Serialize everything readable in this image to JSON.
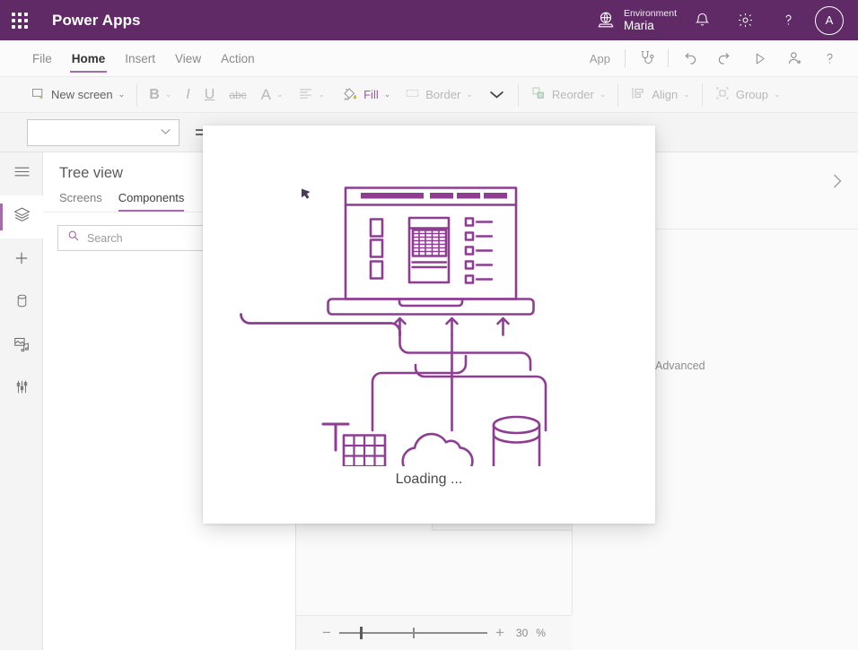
{
  "topbar": {
    "waffle_icon": "app-launcher-waffle-icon",
    "brand": "Power Apps",
    "environment_icon": "environment-globe-icon",
    "environment_label": "Environment",
    "environment_name": "Maria",
    "notifications_icon": "bell-icon",
    "settings_icon": "gear-icon",
    "help_icon": "question-mark-icon",
    "avatar_initial": "A",
    "bg_color": "#5f2a66"
  },
  "menubar": {
    "items": [
      {
        "label": "File",
        "active": false
      },
      {
        "label": "Home",
        "active": true
      },
      {
        "label": "Insert",
        "active": false
      },
      {
        "label": "View",
        "active": false
      },
      {
        "label": "Action",
        "active": false
      }
    ],
    "app_label": "App",
    "app_checker_icon": "stethoscope-icon",
    "undo_icon": "undo-arrow-icon",
    "redo_icon": "redo-arrow-icon",
    "preview_icon": "play-triangle-icon",
    "share_icon": "person-add-icon",
    "help_icon": "question-mark-icon",
    "accent_color": "#a46ca8"
  },
  "ribbon": {
    "new_screen": {
      "label": "New screen",
      "icon": "new-screen-icon",
      "caret": "⌄",
      "enabled": true
    },
    "bold": {
      "label": "B",
      "caret": "⌄"
    },
    "italic": {
      "label": "I"
    },
    "underline": {
      "label": "U"
    },
    "strikethrough": {
      "label": "abc"
    },
    "font_color": {
      "label": "A",
      "caret": "⌄"
    },
    "align": {
      "icon": "align-left-icon",
      "caret": "⌄"
    },
    "fill": {
      "label": "Fill",
      "icon": "paint-bucket-icon",
      "caret": "⌄"
    },
    "border": {
      "label": "Border",
      "icon": "border-icon",
      "caret": "⌄"
    },
    "expand_caret": "⌄",
    "reorder": {
      "label": "Reorder",
      "icon": "reorder-icon",
      "caret": "⌄"
    },
    "align_objects": {
      "label": "Align",
      "icon": "align-objects-icon",
      "caret": "⌄"
    },
    "group": {
      "label": "Group",
      "icon": "group-icon",
      "caret": "⌄"
    }
  },
  "formula_bar": {
    "property_value": "",
    "property_caret": "⌄",
    "equals_icon": "equals-fx-icon"
  },
  "rail": {
    "items": [
      {
        "name": "hamburger-menu",
        "icon": "hamburger-icon",
        "active": false
      },
      {
        "name": "tree-view",
        "icon": "layers-icon",
        "active": true
      },
      {
        "name": "insert",
        "icon": "plus-icon",
        "active": false
      },
      {
        "name": "data",
        "icon": "database-cylinder-icon",
        "active": false
      },
      {
        "name": "media",
        "icon": "media-icon",
        "active": false
      },
      {
        "name": "advanced-tools",
        "icon": "sliders-icon",
        "active": false
      }
    ]
  },
  "tree_panel": {
    "title": "Tree view",
    "tabs": [
      {
        "label": "Screens",
        "active": false
      },
      {
        "label": "Components",
        "active": true
      }
    ],
    "search": {
      "placeholder": "Search",
      "value": "",
      "icon": "search-icon"
    }
  },
  "right_pane": {
    "advanced_label": "Advanced",
    "collapse_icon": "chevron-right-icon"
  },
  "zoom_bar": {
    "minus_label": "−",
    "plus_label": "+",
    "value": "30",
    "unit": "%",
    "slider_icon": "zoom-slider"
  },
  "modal": {
    "illustration_name": "app-data-sources-illustration",
    "illustration_color": "#8e3d93",
    "cursor_icon": "mouse-cursor-icon",
    "laptop_icon": "laptop-screen-icon",
    "spreadsheet_icon": "spreadsheet-table-icon",
    "cloud_icon": "cloud-icon",
    "database_icon": "database-cylinder-icon",
    "loading_text": "Loading ..."
  }
}
